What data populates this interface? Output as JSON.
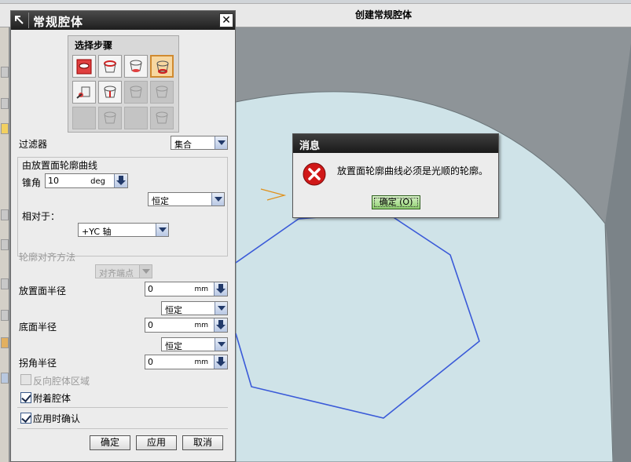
{
  "app": {
    "title": "创建常规腔体"
  },
  "dialog": {
    "title": "常规腔体",
    "close_label": "✕",
    "steps_header": "选择步骤",
    "filter_label": "过滤器",
    "filter_value": "集合",
    "curve_group_title": "由放置面轮廓曲线",
    "taper_label": "锥角",
    "taper_value": "10",
    "taper_unit": "deg",
    "taper_mode": "恒定",
    "relative_label": "相对于：",
    "relative_value": "+YC 轴",
    "align_label": "轮廓对齐方法",
    "align_value": "对齐端点",
    "placement_radius_label": "放置面半径",
    "placement_radius_value": "0",
    "placement_radius_unit": "mm",
    "placement_radius_mode": "恒定",
    "floor_radius_label": "底面半径",
    "floor_radius_value": "0",
    "floor_radius_unit": "mm",
    "floor_radius_mode": "恒定",
    "corner_radius_label": "拐角半径",
    "corner_radius_value": "0",
    "corner_radius_unit": "mm",
    "reverse_region_label": "反向腔体区域",
    "reverse_region_checked": false,
    "attach_label": "附着腔体",
    "attach_checked": true,
    "confirm_on_apply_label": "应用时确认",
    "confirm_on_apply_checked": true,
    "ok_label": "确定",
    "apply_label": "应用",
    "cancel_label": "取消"
  },
  "message": {
    "title": "消息",
    "text": "放置面轮廓曲线必须是光顺的轮廓。",
    "ok_label": "确定 (O)",
    "icon": "error-icon"
  },
  "colors": {
    "viewport_bg": "#8e9498",
    "solid_face": "#cfe3e8",
    "curve": "#3a5ad8",
    "title_bar": "#2a2a2a",
    "error_red": "#d01818",
    "ok_green": "#8fcf70"
  }
}
